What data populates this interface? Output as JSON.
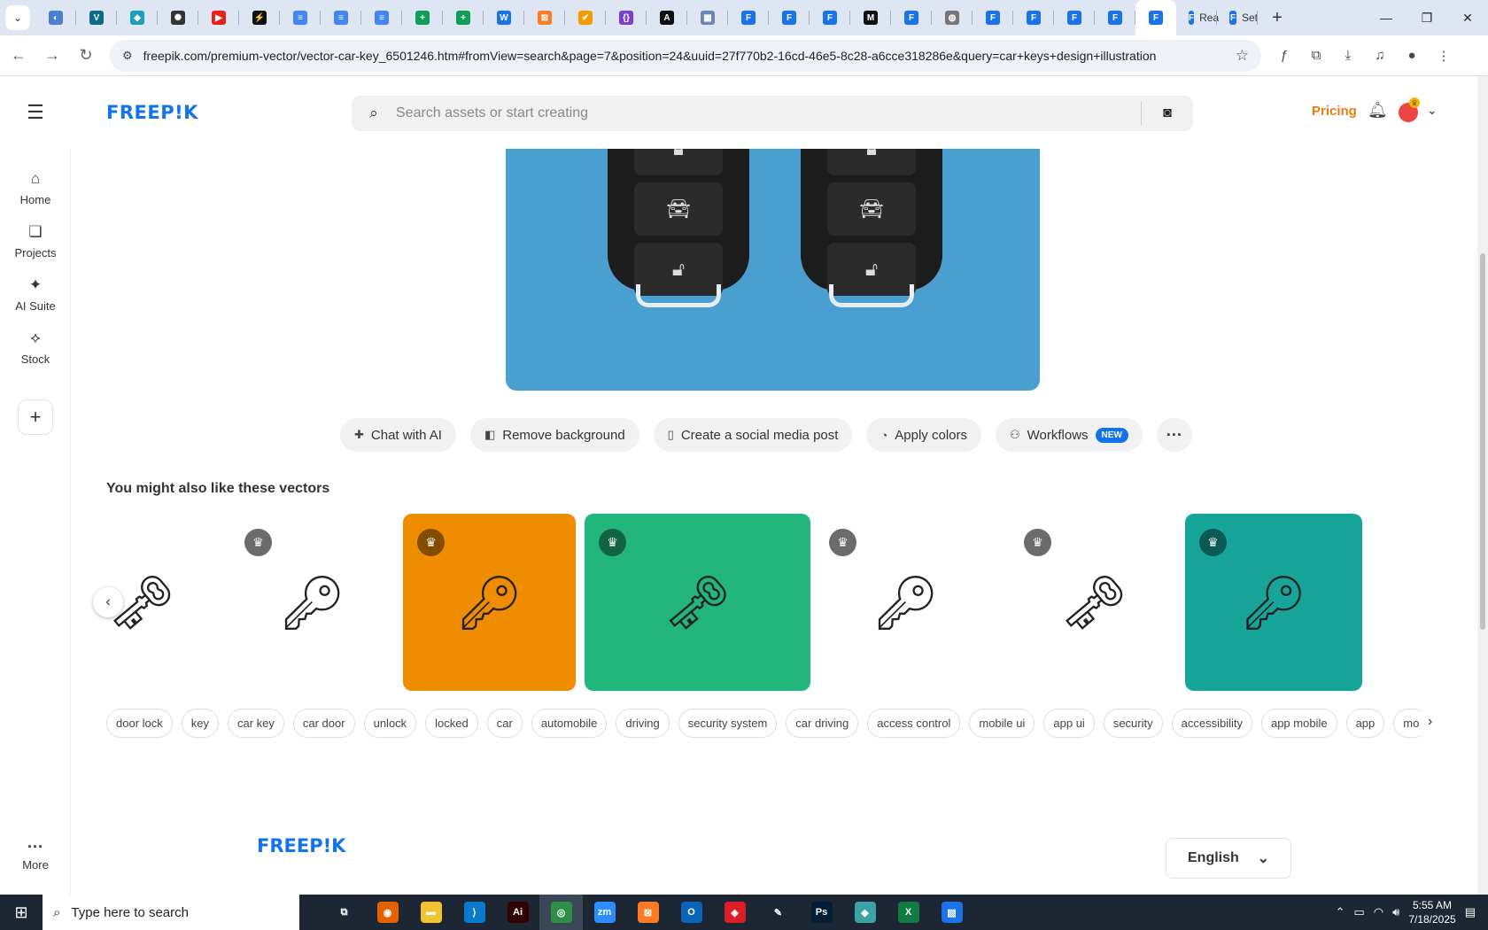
{
  "browser": {
    "tabs": [
      {
        "icon": "blue-sphere-icon",
        "color": "#4a7fd0",
        "glyph": "◐"
      },
      {
        "icon": "teal-v-icon",
        "color": "#0b6b8a",
        "glyph": "V"
      },
      {
        "icon": "cursor-icon",
        "color": "#1aa0b8",
        "glyph": "◆"
      },
      {
        "icon": "openai-icon",
        "color": "#333333",
        "glyph": "✺"
      },
      {
        "icon": "youtube-icon",
        "color": "#e62117",
        "glyph": "▶"
      },
      {
        "icon": "bolt-icon",
        "color": "#111111",
        "glyph": "⚡"
      },
      {
        "icon": "docs-icon",
        "color": "#4285f4",
        "glyph": "≡"
      },
      {
        "icon": "docs-icon",
        "color": "#4285f4",
        "glyph": "≡"
      },
      {
        "icon": "docs-icon",
        "color": "#4285f4",
        "glyph": "≡"
      },
      {
        "icon": "sheets-icon",
        "color": "#0f9d58",
        "glyph": "+"
      },
      {
        "icon": "sheets-icon",
        "color": "#0f9d58",
        "glyph": "+"
      },
      {
        "icon": "wordmark-icon",
        "color": "#1a73e8",
        "glyph": "W"
      },
      {
        "icon": "xampp-icon",
        "color": "#fb7a24",
        "glyph": "⊠"
      },
      {
        "icon": "v-logo-icon",
        "color": "#f59c00",
        "glyph": "✔"
      },
      {
        "icon": "json-icon",
        "color": "#7a3fcf",
        "glyph": "{}"
      },
      {
        "icon": "a-logo-icon",
        "color": "#111111",
        "glyph": "A"
      },
      {
        "icon": "grid-icon",
        "color": "#6b86b5",
        "glyph": "▦"
      },
      {
        "icon": "forms-icon",
        "color": "#1a73e8",
        "glyph": "F"
      },
      {
        "icon": "forms-icon",
        "color": "#1a73e8",
        "glyph": "F"
      },
      {
        "icon": "forms-icon",
        "color": "#1a73e8",
        "glyph": "F"
      },
      {
        "icon": "m-logo-icon",
        "color": "#111111",
        "glyph": "M"
      },
      {
        "icon": "forms-icon",
        "color": "#1a73e8",
        "glyph": "F"
      },
      {
        "icon": "globe-icon",
        "color": "#777777",
        "glyph": "◍"
      },
      {
        "icon": "forms-icon",
        "color": "#1a73e8",
        "glyph": "F"
      },
      {
        "icon": "forms-icon",
        "color": "#1a73e8",
        "glyph": "F"
      },
      {
        "icon": "forms-icon",
        "color": "#1a73e8",
        "glyph": "F"
      },
      {
        "icon": "forms-icon",
        "color": "#1a73e8",
        "glyph": "F"
      },
      {
        "icon": "forms-icon",
        "color": "#1a73e8",
        "glyph": "F",
        "active": true
      },
      {
        "icon": "forms-icon",
        "color": "#1a73e8",
        "glyph": "F",
        "title": "Rea"
      },
      {
        "icon": "forms-icon",
        "color": "#1a73e8",
        "glyph": "F",
        "title": "Set"
      }
    ],
    "url": "freepik.com/premium-vector/vector-car-key_6501246.htm#fromView=search&page=7&position=24&uuid=27f770b2-16cd-46e5-8c28-a6cce318286e&query=car+keys+design+illustration"
  },
  "header": {
    "logo": "FREEP!K",
    "search_placeholder": "Search assets or start creating",
    "pricing": "Pricing"
  },
  "rail": {
    "items": [
      {
        "label": "Home",
        "icon": "home-icon"
      },
      {
        "label": "Projects",
        "icon": "projects-icon"
      },
      {
        "label": "AI Suite",
        "icon": "sparkles-icon"
      },
      {
        "label": "Stock",
        "icon": "stock-icon"
      }
    ],
    "more_label": "More"
  },
  "actions": [
    {
      "label": "Chat with AI",
      "icon": "chat-ai-icon"
    },
    {
      "label": "Remove background",
      "icon": "remove-bg-icon"
    },
    {
      "label": "Create a social media post",
      "icon": "phone-icon"
    },
    {
      "label": "Apply colors",
      "icon": "palette-icon"
    },
    {
      "label": "Workflows",
      "icon": "workflow-icon",
      "badge": "NEW"
    }
  ],
  "related": {
    "title": "You might also like these vectors",
    "items": [
      {
        "bg": "#ffffff",
        "premium": false
      },
      {
        "bg": "#ffffff",
        "premium": true
      },
      {
        "bg": "#ef8c00",
        "premium": true
      },
      {
        "bg": "#22b57c",
        "premium": true
      },
      {
        "bg": "#ffffff",
        "premium": true
      },
      {
        "bg": "#ffffff",
        "premium": true
      },
      {
        "bg": "#17a59a",
        "premium": true
      }
    ]
  },
  "tags": [
    "door lock",
    "key",
    "car key",
    "car door",
    "unlock",
    "locked",
    "car",
    "automobile",
    "driving",
    "security system",
    "car driving",
    "access control",
    "mobile ui",
    "app ui",
    "security",
    "accessibility",
    "app mobile",
    "app",
    "mo"
  ],
  "footer": {
    "logo": "FREEP!K",
    "language": "English"
  },
  "taskbar": {
    "search_placeholder": "Type here to search",
    "apps": [
      {
        "icon": "task-view-icon",
        "color": "#1c2733",
        "glyph": "⧉"
      },
      {
        "icon": "firefox-icon",
        "color": "#e66000",
        "glyph": "◉"
      },
      {
        "icon": "file-explorer-icon",
        "color": "#f2c230",
        "glyph": "▬"
      },
      {
        "icon": "vscode-icon",
        "color": "#0a7acc",
        "glyph": "⟩"
      },
      {
        "icon": "illustrator-icon",
        "color": "#330000",
        "glyph": "Ai"
      },
      {
        "icon": "chrome-icon",
        "color": "#2f8f46",
        "glyph": "◎",
        "active": true
      },
      {
        "icon": "zoom-icon",
        "color": "#2d8cff",
        "glyph": "zm"
      },
      {
        "icon": "xampp-icon",
        "color": "#fb7a24",
        "glyph": "⊠"
      },
      {
        "icon": "outlook-icon",
        "color": "#0a64b8",
        "glyph": "O"
      },
      {
        "icon": "creative-cloud-icon",
        "color": "#da1f26",
        "glyph": "◈"
      },
      {
        "icon": "pen-icon",
        "color": "#1c2733",
        "glyph": "✎"
      },
      {
        "icon": "photoshop-icon",
        "color": "#001e36",
        "glyph": "Ps"
      },
      {
        "icon": "gem-icon",
        "color": "#3aa3a6",
        "glyph": "◆"
      },
      {
        "icon": "excel-icon",
        "color": "#107c41",
        "glyph": "X"
      },
      {
        "icon": "photos-icon",
        "color": "#1a73e8",
        "glyph": "▨"
      }
    ],
    "time": "5:55 AM",
    "date": "7/18/2025"
  }
}
